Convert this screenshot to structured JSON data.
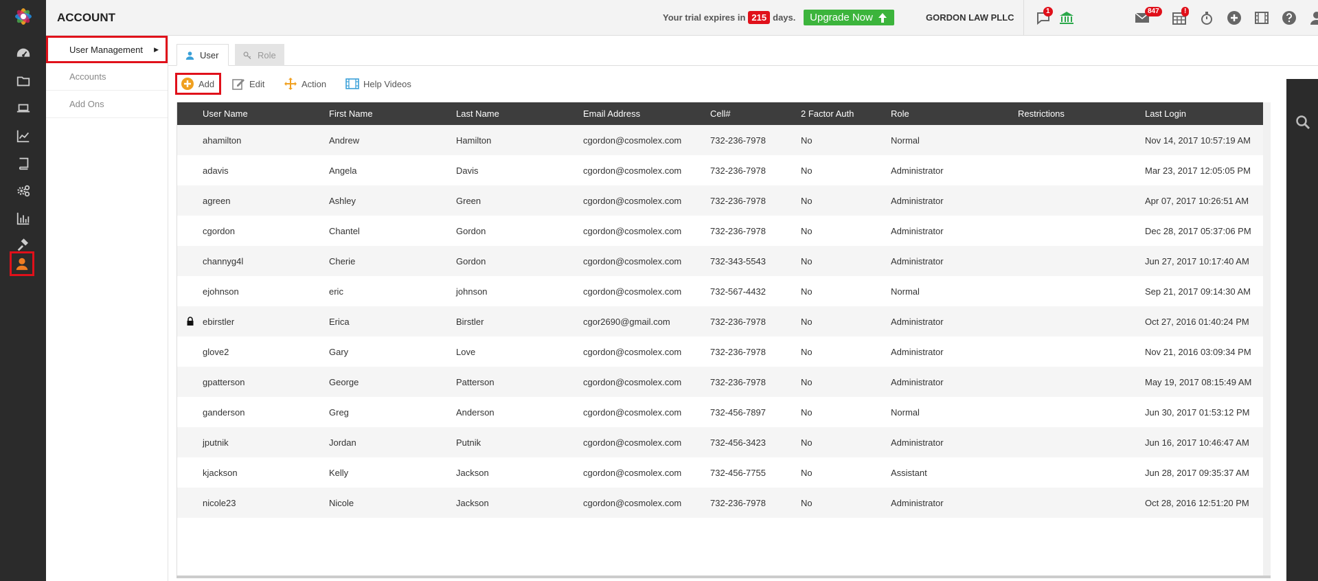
{
  "header": {
    "title": "ACCOUNT",
    "trial_prefix": "Your trial expires in",
    "trial_days": "215",
    "trial_suffix": "days.",
    "upgrade_label": "Upgrade Now",
    "firm_name": "GORDON LAW PLLC",
    "chat_badge": "1",
    "mail_badge": "847",
    "calendar_badge": "!"
  },
  "subnav": {
    "items": [
      {
        "label": "User Management"
      },
      {
        "label": "Accounts"
      },
      {
        "label": "Add Ons"
      }
    ]
  },
  "tabs": [
    {
      "label": "User"
    },
    {
      "label": "Role"
    }
  ],
  "toolbar": {
    "add_label": "Add",
    "edit_label": "Edit",
    "action_label": "Action",
    "help_label": "Help Videos"
  },
  "table": {
    "columns": [
      "User Name",
      "First Name",
      "Last Name",
      "Email Address",
      "Cell#",
      "2 Factor Auth",
      "Role",
      "Restrictions",
      "Last Login"
    ],
    "rows": [
      {
        "user": "ahamilton",
        "first": "Andrew",
        "last": "Hamilton",
        "email": "cgordon@cosmolex.com",
        "cell": "732-236-7978",
        "tfa": "No",
        "role": "Normal",
        "restrictions": "",
        "login": "Nov 14, 2017 10:57:19 AM",
        "locked": false
      },
      {
        "user": "adavis",
        "first": "Angela",
        "last": "Davis",
        "email": "cgordon@cosmolex.com",
        "cell": "732-236-7978",
        "tfa": "No",
        "role": "Administrator",
        "restrictions": "",
        "login": "Mar 23, 2017 12:05:05 PM",
        "locked": false
      },
      {
        "user": "agreen",
        "first": "Ashley",
        "last": "Green",
        "email": "cgordon@cosmolex.com",
        "cell": "732-236-7978",
        "tfa": "No",
        "role": "Administrator",
        "restrictions": "",
        "login": "Apr 07, 2017 10:26:51 AM",
        "locked": false
      },
      {
        "user": "cgordon",
        "first": "Chantel",
        "last": "Gordon",
        "email": "cgordon@cosmolex.com",
        "cell": "732-236-7978",
        "tfa": "No",
        "role": "Administrator",
        "restrictions": "",
        "login": "Dec 28, 2017 05:37:06 PM",
        "locked": false
      },
      {
        "user": "channyg4l",
        "first": "Cherie",
        "last": "Gordon",
        "email": "cgordon@cosmolex.com",
        "cell": "732-343-5543",
        "tfa": "No",
        "role": "Administrator",
        "restrictions": "",
        "login": "Jun 27, 2017 10:17:40 AM",
        "locked": false
      },
      {
        "user": "ejohnson",
        "first": "eric",
        "last": "johnson",
        "email": "cgordon@cosmolex.com",
        "cell": "732-567-4432",
        "tfa": "No",
        "role": "Normal",
        "restrictions": "",
        "login": "Sep 21, 2017 09:14:30 AM",
        "locked": false
      },
      {
        "user": "ebirstler",
        "first": "Erica",
        "last": "Birstler",
        "email": "cgor2690@gmail.com",
        "cell": "732-236-7978",
        "tfa": "No",
        "role": "Administrator",
        "restrictions": "",
        "login": "Oct 27, 2016 01:40:24 PM",
        "locked": true
      },
      {
        "user": "glove2",
        "first": "Gary",
        "last": "Love",
        "email": "cgordon@cosmolex.com",
        "cell": "732-236-7978",
        "tfa": "No",
        "role": "Administrator",
        "restrictions": "",
        "login": "Nov 21, 2016 03:09:34 PM",
        "locked": false
      },
      {
        "user": "gpatterson",
        "first": "George",
        "last": "Patterson",
        "email": "cgordon@cosmolex.com",
        "cell": "732-236-7978",
        "tfa": "No",
        "role": "Administrator",
        "restrictions": "",
        "login": "May 19, 2017 08:15:49 AM",
        "locked": false
      },
      {
        "user": "ganderson",
        "first": "Greg",
        "last": "Anderson",
        "email": "cgordon@cosmolex.com",
        "cell": "732-456-7897",
        "tfa": "No",
        "role": "Normal",
        "restrictions": "",
        "login": "Jun 30, 2017 01:53:12 PM",
        "locked": false
      },
      {
        "user": "jputnik",
        "first": "Jordan",
        "last": "Putnik",
        "email": "cgordon@cosmolex.com",
        "cell": "732-456-3423",
        "tfa": "No",
        "role": "Administrator",
        "restrictions": "",
        "login": "Jun 16, 2017 10:46:47 AM",
        "locked": false
      },
      {
        "user": "kjackson",
        "first": "Kelly",
        "last": "Jackson",
        "email": "cgordon@cosmolex.com",
        "cell": "732-456-7755",
        "tfa": "No",
        "role": "Assistant",
        "restrictions": "",
        "login": "Jun 28, 2017 09:35:37 AM",
        "locked": false
      },
      {
        "user": "nicole23",
        "first": "Nicole",
        "last": "Jackson",
        "email": "cgordon@cosmolex.com",
        "cell": "732-236-7978",
        "tfa": "No",
        "role": "Administrator",
        "restrictions": "",
        "login": "Oct 28, 2016 12:51:20 PM",
        "locked": false
      }
    ]
  },
  "colors": {
    "accent_red": "#e0101a",
    "upgrade_green": "#3cb43c",
    "rail_dark": "#2b2b2b",
    "header_row": "#3d3d3d",
    "active_user_icon": "#f07c22",
    "toolbar_orange": "#f0a020",
    "bank_green": "#2aa84a",
    "bulb_blue": "#2a7fd4"
  }
}
